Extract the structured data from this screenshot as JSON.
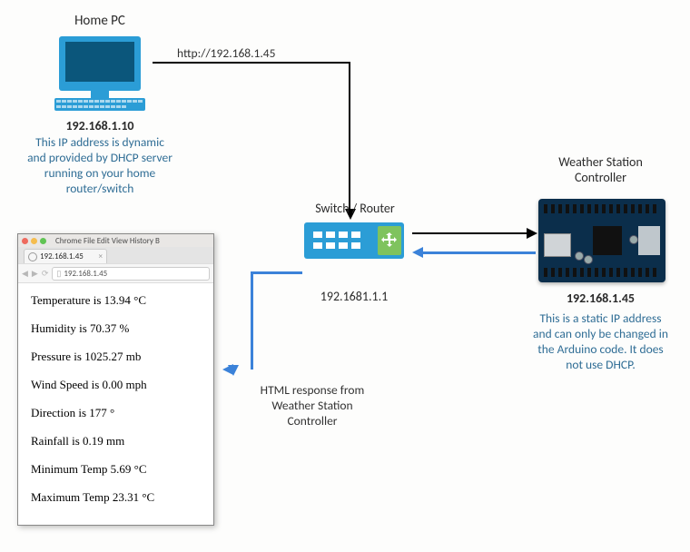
{
  "homePC": {
    "title": "Home PC",
    "ip": "192.168.1.10",
    "desc_l1": "This IP address is dynamic",
    "desc_l2": "and provided by DHCP server",
    "desc_l3": "running on your home",
    "desc_l4": "router/switch"
  },
  "switch": {
    "title": "Switch / Router",
    "ip": "192.1681.1.1"
  },
  "controller": {
    "title_l1": "Weather Station",
    "title_l2": "Controller",
    "ip": "192.168.1.45",
    "desc_l1": "This is a static IP address",
    "desc_l2": "and can only be changed in",
    "desc_l3": "the Arduino code. It does",
    "desc_l4": "not use DHCP."
  },
  "edges": {
    "http_request": "http://192.168.1.45",
    "response_l1": "HTML response from",
    "response_l2": "Weather Station",
    "response_l3": "Controller"
  },
  "browser": {
    "menu": "Chrome   File   Edit   View   History   B",
    "tab_title": "192.168.1.45",
    "address": "192.168.1.45",
    "lines": {
      "temp": "Temperature is 13.94 °C",
      "humidity": "Humidity is 70.37 %",
      "pressure": "Pressure is 1025.27 mb",
      "wind": "Wind Speed is 0.00 mph",
      "dir": "Direction is 177 °",
      "rain": "Rainfall is 0.19 mm",
      "min": "Minimum Temp 5.69 °C",
      "max": "Maximum Temp 23.31 °C"
    }
  }
}
